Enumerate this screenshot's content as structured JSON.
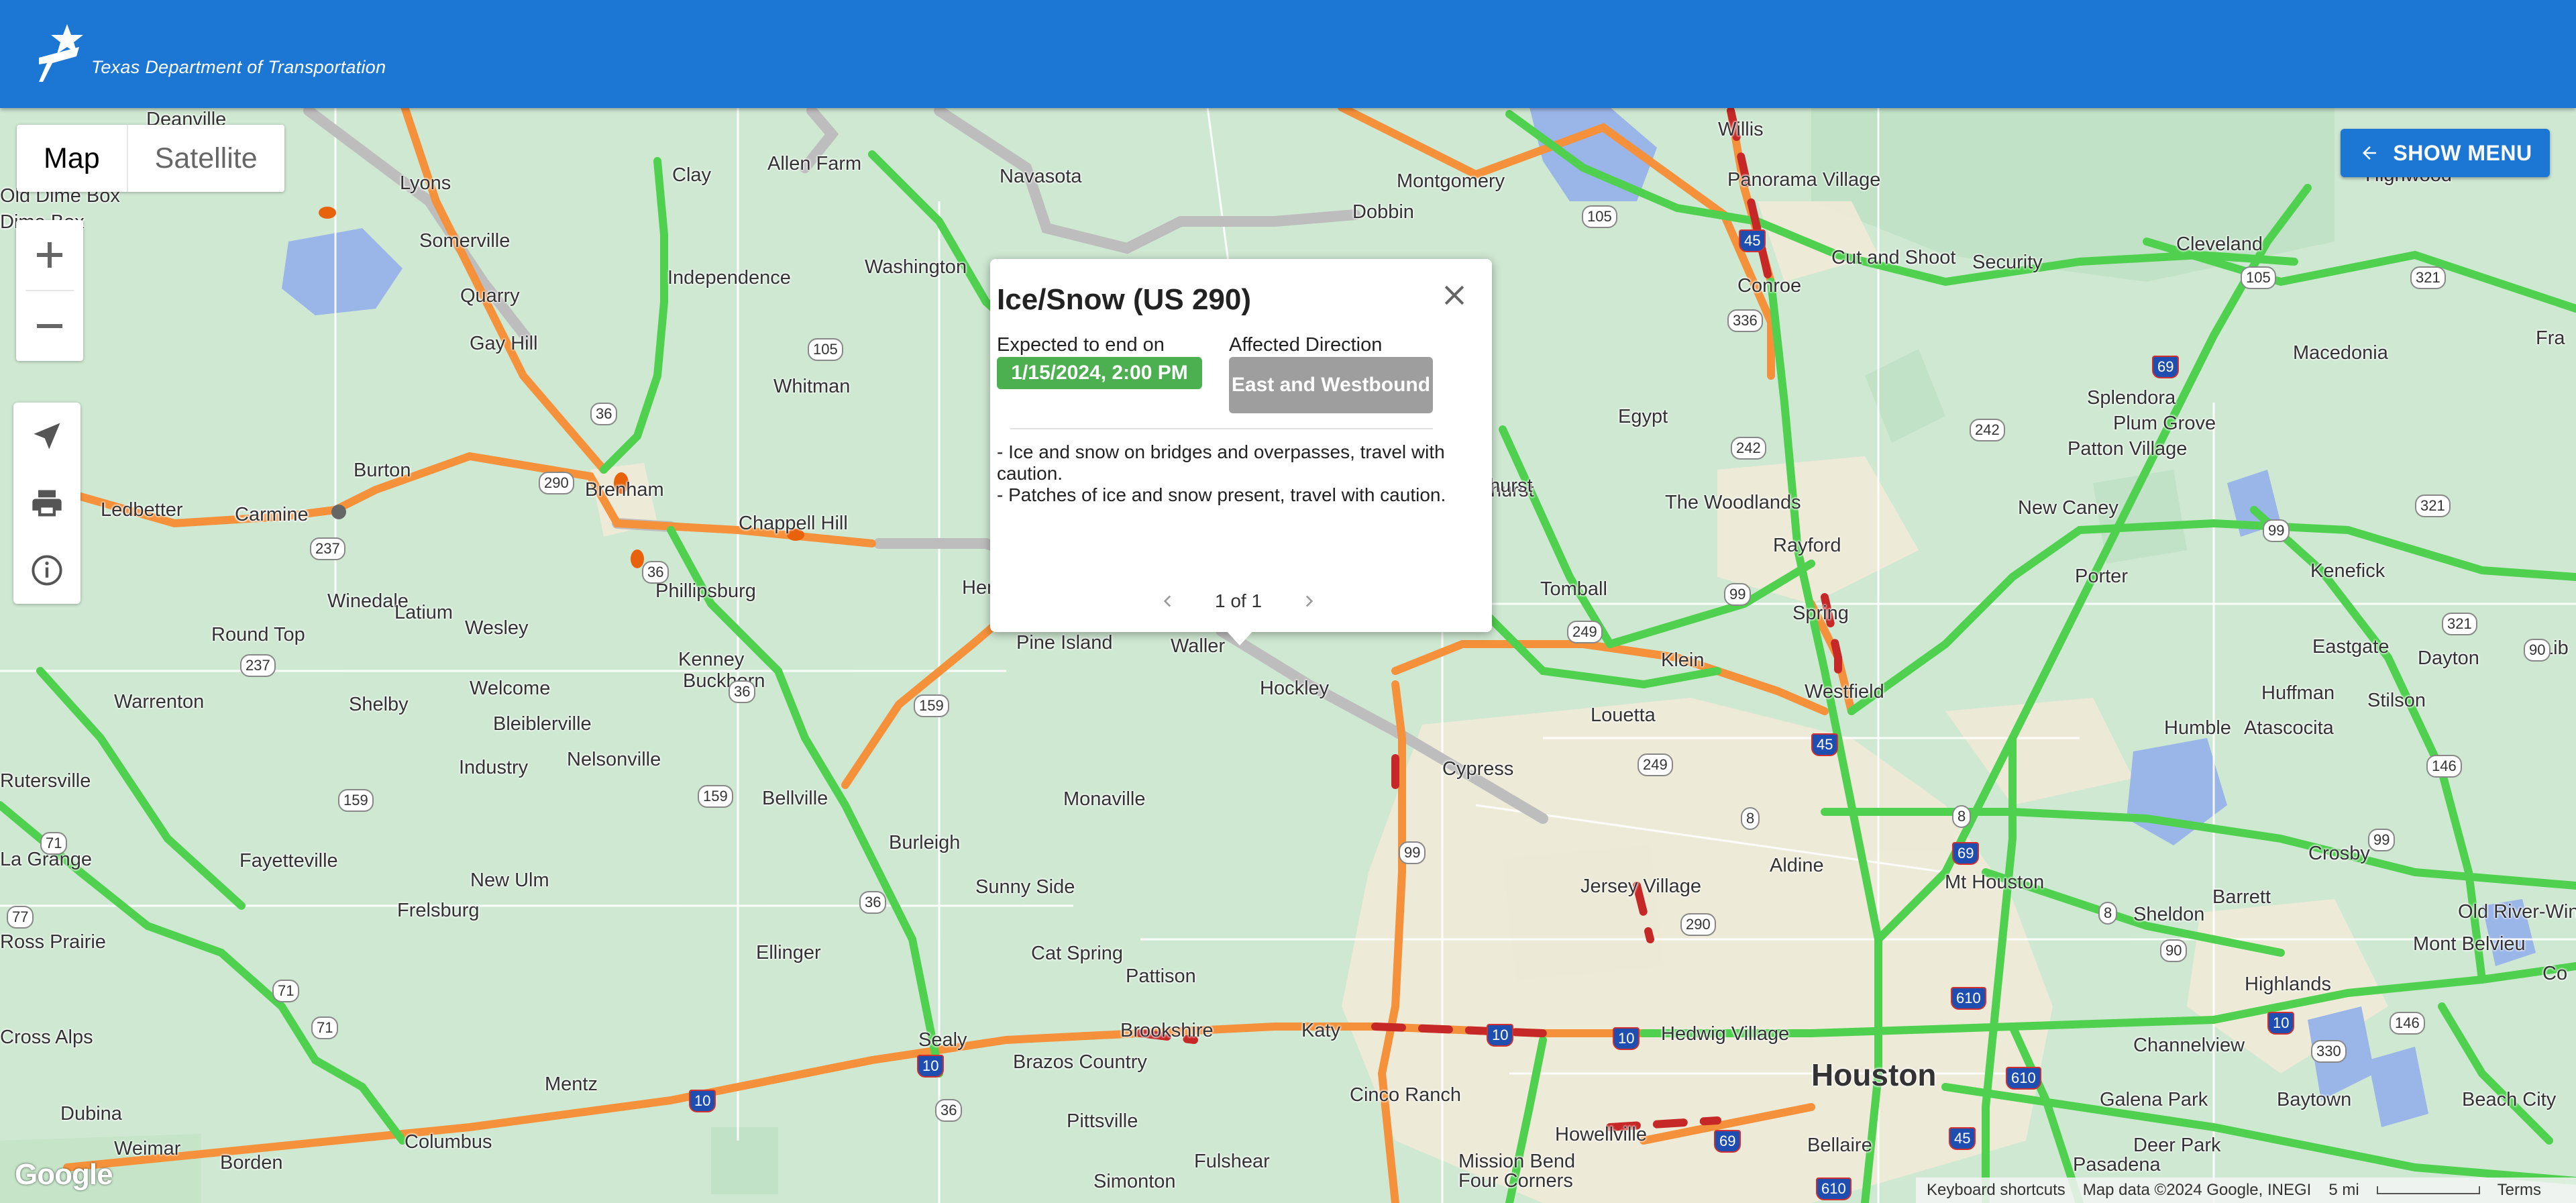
{
  "header": {
    "agency_name": "Texas Department of Transportation"
  },
  "map_type": {
    "map_label": "Map",
    "satellite_label": "Satellite",
    "selected": "Map"
  },
  "controls": {
    "show_menu_label": "SHOW MENU"
  },
  "popup": {
    "title": "Ice/Snow (US 290)",
    "end_label": "Expected to end on",
    "end_value": "1/15/2024, 2:00 PM",
    "direction_label": "Affected Direction",
    "direction_value": "East and Westbound",
    "description_lines": [
      "- Ice and snow on bridges and overpasses, travel with caution.",
      "- Patches of ice and snow present, travel with caution."
    ],
    "pager": "1 of 1"
  },
  "attribution": {
    "keyboard": "Keyboard shortcuts",
    "data": "Map data ©2024 Google, INEGI",
    "scale": "5 mi",
    "terms": "Terms"
  },
  "google_logo": "Google",
  "colors": {
    "header": "#1c76d4",
    "land": "#cfe8d2",
    "urban": "#f1ead8",
    "road_fast": "#4fd14f",
    "road_slow": "#f4913a",
    "road_jam": "#c62828",
    "closed_road": "#bdbdbd",
    "water": "#9ab5e8",
    "badge_date": "#4caf50",
    "badge_direction": "#9e9e9e"
  },
  "map_labels": [
    {
      "t": "Deanville"
    },
    {
      "t": "Lyons"
    },
    {
      "t": "Clay"
    },
    {
      "t": "Allen Farm"
    },
    {
      "t": "Navasota"
    },
    {
      "t": "Montgomery"
    },
    {
      "t": "Willis"
    },
    {
      "t": "Panorama Village"
    },
    {
      "t": "Old Dime Box"
    },
    {
      "t": "Dime Box"
    },
    {
      "t": "Somerville"
    },
    {
      "t": "Independence"
    },
    {
      "t": "Washington"
    },
    {
      "t": "Dobbin"
    },
    {
      "t": "Pinehurst"
    },
    {
      "t": "Conroe"
    },
    {
      "t": "Cut and Shoot"
    },
    {
      "t": "Security"
    },
    {
      "t": "Cleveland"
    },
    {
      "t": "Highwood"
    },
    {
      "t": "Quarry"
    },
    {
      "t": "Gay Hill"
    },
    {
      "t": "Whitman"
    },
    {
      "t": "Macedonia"
    },
    {
      "t": "Egypt"
    },
    {
      "t": "Splendora"
    },
    {
      "t": "Plum Grove"
    },
    {
      "t": "Patton Village"
    },
    {
      "t": "Ledbetter"
    },
    {
      "t": "Carmine"
    },
    {
      "t": "Burton"
    },
    {
      "t": "Brenham"
    },
    {
      "t": "Chappell Hill"
    },
    {
      "t": "Hempstead"
    },
    {
      "t": "Pinehurst"
    },
    {
      "t": "The Woodlands"
    },
    {
      "t": "Rayford"
    },
    {
      "t": "New Caney"
    },
    {
      "t": "Winedale"
    },
    {
      "t": "Latium"
    },
    {
      "t": "Wesley"
    },
    {
      "t": "Phillipsburg"
    },
    {
      "t": "Tomball"
    },
    {
      "t": "Spring"
    },
    {
      "t": "Porter"
    },
    {
      "t": "Kenefick"
    },
    {
      "t": "Round Top"
    },
    {
      "t": "Kenney"
    },
    {
      "t": "Pine Island"
    },
    {
      "t": "Waller"
    },
    {
      "t": "Klein"
    },
    {
      "t": "Eastgate"
    },
    {
      "t": "Dayton"
    },
    {
      "t": "Warrenton"
    },
    {
      "t": "Shelby"
    },
    {
      "t": "Welcome"
    },
    {
      "t": "Buckhorn"
    },
    {
      "t": "Hockley"
    },
    {
      "t": "Westfield"
    },
    {
      "t": "Huffman"
    },
    {
      "t": "Stilson"
    },
    {
      "t": "Bleiblerville"
    },
    {
      "t": "Louetta"
    },
    {
      "t": "Humble"
    },
    {
      "t": "Atascocita"
    },
    {
      "t": "Industry"
    },
    {
      "t": "Nelsonville"
    },
    {
      "t": "Cypress"
    },
    {
      "t": "Rutersville"
    },
    {
      "t": "Bellville"
    },
    {
      "t": "Monaville"
    },
    {
      "t": "Fayetteville"
    },
    {
      "t": "Burleigh"
    },
    {
      "t": "Aldine"
    },
    {
      "t": "Crosby"
    },
    {
      "t": "La Grange"
    },
    {
      "t": "New Ulm"
    },
    {
      "t": "Sunny Side"
    },
    {
      "t": "Jersey Village"
    },
    {
      "t": "Mt Houston"
    },
    {
      "t": "Barrett"
    },
    {
      "t": "Sheldon"
    },
    {
      "t": "Old River-Winfree"
    },
    {
      "t": "Frelsburg"
    },
    {
      "t": "Mont Belvieu"
    },
    {
      "t": "Ellinger"
    },
    {
      "t": "Cat Spring"
    },
    {
      "t": "Pattison"
    },
    {
      "t": "Highlands"
    },
    {
      "t": "Sealy"
    },
    {
      "t": "Brookshire"
    },
    {
      "t": "Katy"
    },
    {
      "t": "Hedwig Village"
    },
    {
      "t": "Houston"
    },
    {
      "t": "Channelview"
    },
    {
      "t": "Brazos Country"
    },
    {
      "t": "Galena Park"
    },
    {
      "t": "Baytown"
    },
    {
      "t": "Beach City"
    },
    {
      "t": "Mentz"
    },
    {
      "t": "Cinco Ranch"
    },
    {
      "t": "Dubina"
    },
    {
      "t": "Columbus"
    },
    {
      "t": "Pittsville"
    },
    {
      "t": "Howellville"
    },
    {
      "t": "Bellaire"
    },
    {
      "t": "Deer Park"
    },
    {
      "t": "Weimar"
    },
    {
      "t": "Borden"
    },
    {
      "t": "Fulshear"
    },
    {
      "t": "Mission Bend"
    },
    {
      "t": "Four Corners"
    },
    {
      "t": "Pasadena"
    },
    {
      "t": "Simonton"
    },
    {
      "t": "Ross Prairie"
    },
    {
      "t": "Cross Alps"
    },
    {
      "t": "Fra"
    },
    {
      "t": "Lib"
    },
    {
      "t": "Co"
    },
    {
      "t": "Carmine"
    },
    {
      "t": "Dime Box"
    }
  ],
  "shields": [
    {
      "t": "105"
    },
    {
      "t": "105"
    },
    {
      "t": "105"
    },
    {
      "t": "321"
    },
    {
      "t": "45"
    },
    {
      "t": "336"
    },
    {
      "t": "69"
    },
    {
      "t": "242"
    },
    {
      "t": "242"
    },
    {
      "t": "99"
    },
    {
      "t": "321"
    },
    {
      "t": "36"
    },
    {
      "t": "290"
    },
    {
      "t": "237"
    },
    {
      "t": "36"
    },
    {
      "t": "99"
    },
    {
      "t": "249"
    },
    {
      "t": "321"
    },
    {
      "t": "90"
    },
    {
      "t": "237"
    },
    {
      "t": "36"
    },
    {
      "t": "159"
    },
    {
      "t": "45"
    },
    {
      "t": "146"
    },
    {
      "t": "159"
    },
    {
      "t": "159"
    },
    {
      "t": "249"
    },
    {
      "t": "8"
    },
    {
      "t": "8"
    },
    {
      "t": "99"
    },
    {
      "t": "71"
    },
    {
      "t": "99"
    },
    {
      "t": "69"
    },
    {
      "t": "36"
    },
    {
      "t": "290"
    },
    {
      "t": "8"
    },
    {
      "t": "77"
    },
    {
      "t": "90"
    },
    {
      "t": "71"
    },
    {
      "t": "610"
    },
    {
      "t": "71"
    },
    {
      "t": "10"
    },
    {
      "t": "10"
    },
    {
      "t": "146"
    },
    {
      "t": "10"
    },
    {
      "t": "10"
    },
    {
      "t": "330"
    },
    {
      "t": "610"
    },
    {
      "t": "10"
    },
    {
      "t": "36"
    },
    {
      "t": "45"
    },
    {
      "t": "69"
    },
    {
      "t": "610"
    }
  ]
}
